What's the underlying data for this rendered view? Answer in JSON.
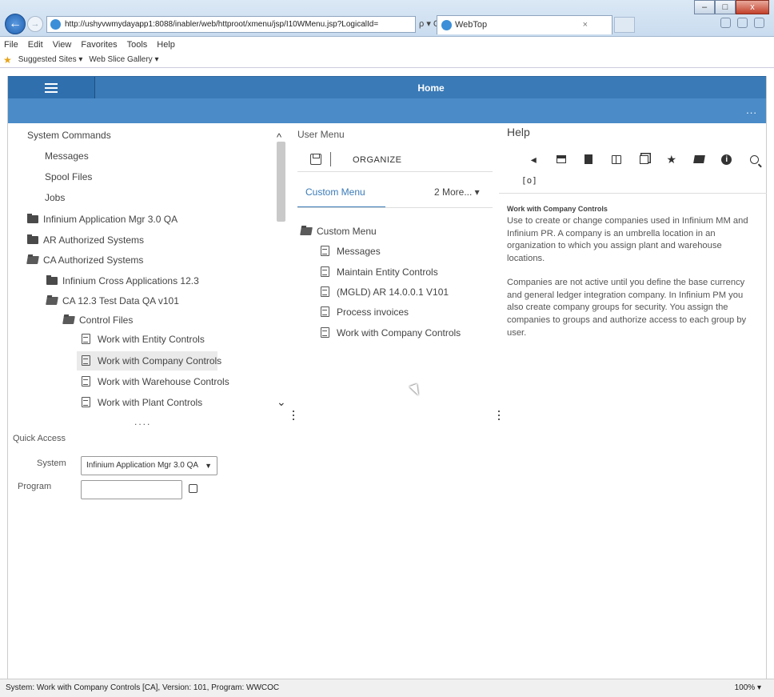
{
  "browser": {
    "url": "http://ushyvwmydayapp1:8088/inabler/web/httproot/xmenu/jsp/I10WMenu.jsp?LogicalId=",
    "addr_tools": "ρ ▾ C",
    "tab_title": "WebTop",
    "tab_close": "×",
    "menu": [
      "File",
      "Edit",
      "View",
      "Favorites",
      "Tools",
      "Help"
    ],
    "favorites": [
      "Suggested Sites ▾",
      "Web Slice Gallery ▾"
    ],
    "win_min": "–",
    "win_max": "□",
    "win_close": "x"
  },
  "header": {
    "title": "Home",
    "more": "..."
  },
  "left": {
    "items": [
      {
        "label": "System Commands"
      },
      {
        "label": "Messages"
      },
      {
        "label": "Spool Files"
      },
      {
        "label": "Jobs"
      },
      {
        "label": "Infinium Application Mgr 3.0 QA"
      },
      {
        "label": "AR Authorized Systems"
      },
      {
        "label": "CA Authorized Systems"
      },
      {
        "label": "Infinium Cross Applications 12.3"
      },
      {
        "label": "CA 12.3 Test Data QA v101"
      },
      {
        "label": "Control Files"
      },
      {
        "label": "Work with Entity Controls"
      },
      {
        "label": "Work with Company Controls"
      },
      {
        "label": "Work with Warehouse Controls"
      },
      {
        "label": "Work with Plant Controls"
      }
    ],
    "more_dots": "....",
    "scroll_up": "^",
    "scroll_down": "⌄"
  },
  "quick_access": {
    "title": "Quick Access",
    "system_label": "System",
    "system_value": "Infinium Application Mgr 3.0 QA",
    "program_label": "Program",
    "program_value": ""
  },
  "user_menu": {
    "title": "User Menu",
    "organize": "ORGANIZE",
    "tab": "Custom Menu",
    "more": "2 More... ▾",
    "root": "Custom Menu",
    "items": [
      "Messages",
      "Maintain Entity Controls",
      "(MGLD) AR 14.0.0.1 V101",
      "Process invoices",
      "Work with Company Controls"
    ]
  },
  "help": {
    "title": "Help",
    "toolbar": [
      "back-icon",
      "print-icon",
      "contents-icon",
      "book-icon",
      "copy-icon",
      "favorite-icon",
      "folder-icon",
      "info-icon",
      "search-icon"
    ],
    "bracket": "[o]",
    "heading": "Work with Company Controls",
    "p1": "Use to create or change companies used in Infinium MM and Infinium PR. A company is an umbrella location in an organization to which you assign plant and warehouse locations.",
    "p2": "Companies are not active until you define the base currency and general ledger integration company. In Infinium PM you also create company groups for security. You assign the companies to groups and authorize access to each group by user."
  },
  "status": {
    "text": "System: Work with Company Controls [CA], Version: 101, Program: WWCOC",
    "zoom": "100% ▾"
  },
  "colors": {
    "header": "#3a7ab7",
    "subbar": "#4a8bc8",
    "accent": "#3a7ab7"
  }
}
